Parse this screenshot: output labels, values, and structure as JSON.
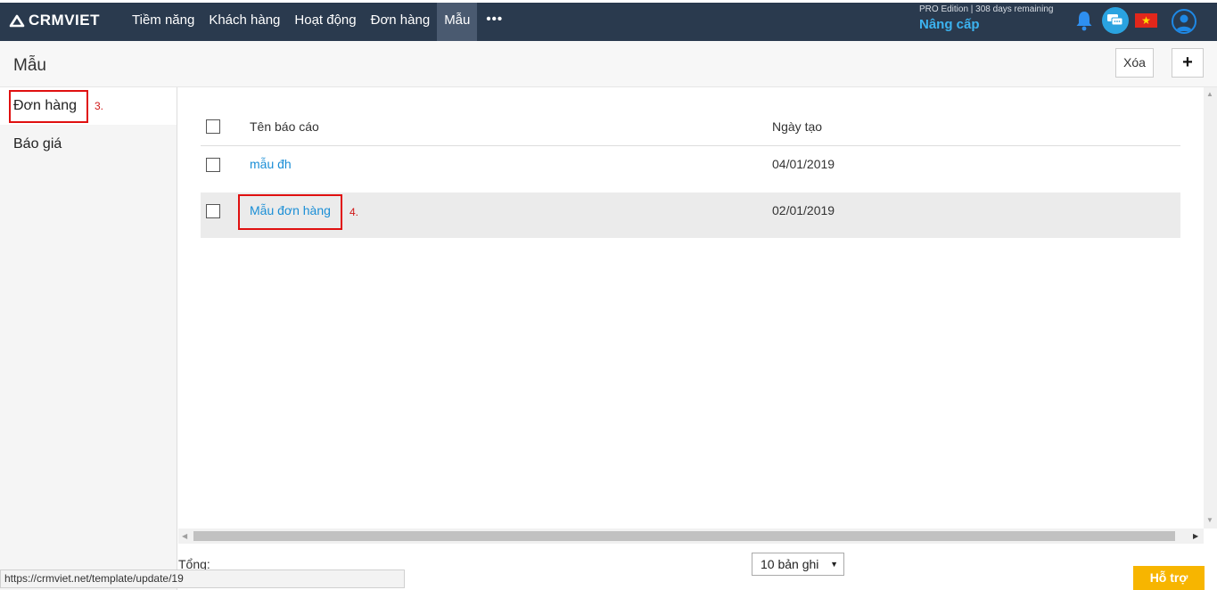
{
  "app": {
    "logo_text": "CRMVIET"
  },
  "nav": {
    "items": [
      {
        "label": "Tiềm năng",
        "active": false
      },
      {
        "label": "Khách hàng",
        "active": false
      },
      {
        "label": "Hoạt động",
        "active": false
      },
      {
        "label": "Đơn hàng",
        "active": false
      },
      {
        "label": "Mẫu",
        "active": true
      }
    ],
    "more_label": "•••",
    "edition_text": "PRO Edition | 308 days remaining",
    "upgrade_label": "Nâng cấp",
    "icons": [
      "bell-icon",
      "chat-icon",
      "vietnam-flag-icon",
      "user-avatar-icon"
    ]
  },
  "page": {
    "title": "Mẫu",
    "delete_label": "Xóa",
    "add_label": "+"
  },
  "sidebar": {
    "items": [
      {
        "label": "Đơn hàng",
        "active": true
      },
      {
        "label": "Báo giá",
        "active": false
      }
    ]
  },
  "annotations": {
    "step3": "3.",
    "step4": "4."
  },
  "table": {
    "columns": [
      "Tên báo cáo",
      "Ngày tạo"
    ],
    "rows": [
      {
        "name": "mẫu đh",
        "date": "04/01/2019"
      },
      {
        "name": "Mẫu đơn hàng",
        "date": "02/01/2019"
      }
    ]
  },
  "footer": {
    "total_label": "Tổng:",
    "page_size": "10 bản ghi",
    "support_label": "Hỗ trợ"
  },
  "statusbar": {
    "url": "https://crmviet.net/template/update/19"
  },
  "colors": {
    "navbar": "#2a3a4e",
    "link": "#1a8ed6",
    "highlight": "#e01010",
    "support": "#f7b500"
  }
}
